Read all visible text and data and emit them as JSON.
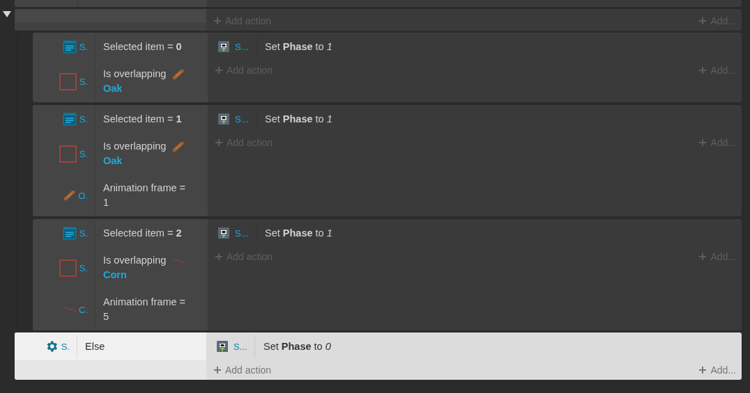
{
  "group": {
    "expanded": true,
    "add_action": "Add action",
    "add_other": "Add...",
    "events": [
      {
        "selected": false,
        "conditions": [
          {
            "kind": "selection",
            "object": {
              "name": "S.",
              "kind": "list"
            },
            "text": "Selected item  =  **0**"
          },
          {
            "kind": "overlap",
            "object": {
              "name": "S.",
              "kind": "box"
            },
            "text": "Is overlapping",
            "target": {
              "name": "Oak",
              "kind": "log"
            }
          }
        ],
        "actions": [
          {
            "object": "S...",
            "text": "Set **Phase** to *1*"
          }
        ],
        "add_action": "Add action",
        "add_other": "Add..."
      },
      {
        "selected": false,
        "conditions": [
          {
            "kind": "selection",
            "object": {
              "name": "S.",
              "kind": "list"
            },
            "text": "Selected item  =  **1**"
          },
          {
            "kind": "overlap",
            "object": {
              "name": "S.",
              "kind": "box"
            },
            "text": "Is overlapping",
            "target": {
              "name": "Oak",
              "kind": "log"
            }
          },
          {
            "kind": "frame",
            "object": {
              "name": "O.",
              "kind": "log"
            },
            "text": "Animation frame = 1"
          }
        ],
        "actions": [
          {
            "object": "S...",
            "text": "Set **Phase** to *1*"
          }
        ],
        "add_action": "Add action",
        "add_other": "Add..."
      },
      {
        "selected": false,
        "conditions": [
          {
            "kind": "selection",
            "object": {
              "name": "S.",
              "kind": "list"
            },
            "text": "Selected item  =  **2**"
          },
          {
            "kind": "overlap",
            "object": {
              "name": "S.",
              "kind": "box"
            },
            "text": "Is overlapping",
            "target": {
              "name": "Corn",
              "kind": "corn"
            }
          },
          {
            "kind": "frame",
            "object": {
              "name": "C.",
              "kind": "corn"
            },
            "text": "Animation frame = 5"
          }
        ],
        "actions": [
          {
            "object": "S...",
            "text": "Set **Phase** to *1*"
          }
        ],
        "add_action": "Add action",
        "add_other": "Add..."
      }
    ]
  },
  "else_event": {
    "selected": true,
    "conditions": [
      {
        "kind": "else",
        "object": {
          "name": "S.",
          "kind": "gear"
        },
        "text": "Else"
      }
    ],
    "actions": [
      {
        "object": "S...",
        "text": "Set **Phase** to *0*"
      }
    ],
    "add_action": "Add action",
    "add_other": "Add..."
  }
}
